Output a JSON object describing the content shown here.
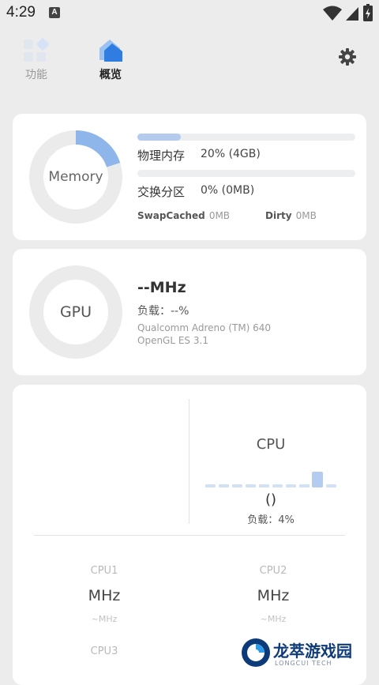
{
  "status_bar": {
    "time": "4:29",
    "notification_badge": "A"
  },
  "tabs": [
    {
      "label": "功能",
      "active": false
    },
    {
      "label": "概览",
      "active": true
    }
  ],
  "memory": {
    "ring_label": "Memory",
    "ring_usage_fraction": 0.2,
    "physical": {
      "label": "物理内存",
      "value": "20% (4GB)",
      "fraction": 0.2
    },
    "swap": {
      "label": "交换分区",
      "value": "0% (0MB)",
      "fraction": 0.0
    },
    "swap_cached": {
      "label": "SwapCached",
      "value": "0MB"
    },
    "dirty": {
      "label": "Dirty",
      "value": "0MB"
    }
  },
  "gpu": {
    "ring_label": "GPU",
    "frequency": "--MHz",
    "load": "负载：--%",
    "model": "Qualcomm Adreno (TM) 640",
    "api": "OpenGL ES 3.1"
  },
  "cpu": {
    "title": "CPU",
    "value": "()",
    "load": "负载：4%",
    "cores": [
      {
        "label": "CPU1",
        "value": "MHz",
        "sub": "~MHz"
      },
      {
        "label": "CPU2",
        "value": "MHz",
        "sub": "~MHz"
      },
      {
        "label": "CPU3"
      }
    ]
  },
  "watermark": {
    "text": "龙萃游戏园",
    "subtext": "LONGCUI TECH"
  },
  "colors": {
    "accent": "#5b9ae6",
    "ring_track": "#ebebeb",
    "ring_fill": "#8fb6ea",
    "bar_fill": "#b5cbee"
  }
}
